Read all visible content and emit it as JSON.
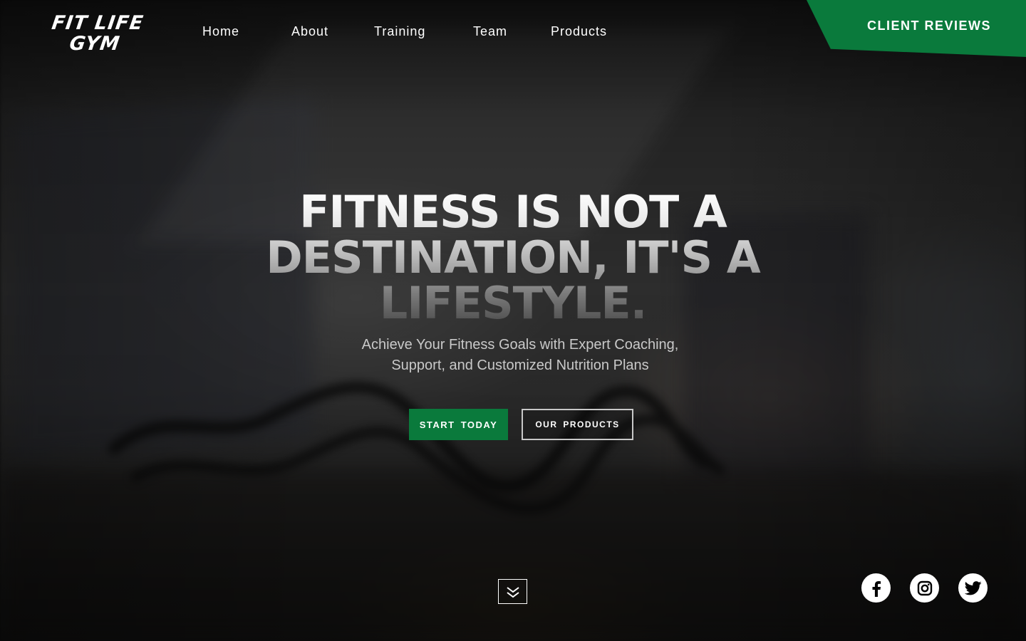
{
  "brand": {
    "logo_line1": "FIT LIFE",
    "logo_line2": "GYM"
  },
  "nav": {
    "items": [
      {
        "label": "Home"
      },
      {
        "label": "About"
      },
      {
        "label": "Training"
      },
      {
        "label": "Team"
      },
      {
        "label": "Products"
      }
    ]
  },
  "header": {
    "reviews_label": "CLIENT REVIEWS"
  },
  "hero": {
    "title": "FITNESS IS NOT A DESTINATION, IT'S A LIFESTYLE.",
    "subtitle": "Achieve Your Fitness Goals with Expert Coaching, Support, and Customized Nutrition Plans",
    "primary_button": "START TODAY",
    "secondary_button": "OUR PRODUCTS"
  },
  "social": {
    "icons": [
      "facebook-icon",
      "instagram-icon",
      "twitter-icon"
    ]
  },
  "colors": {
    "accent": "#0a7a3c",
    "text": "#ffffff",
    "subtitle": "#c9c9c9"
  }
}
